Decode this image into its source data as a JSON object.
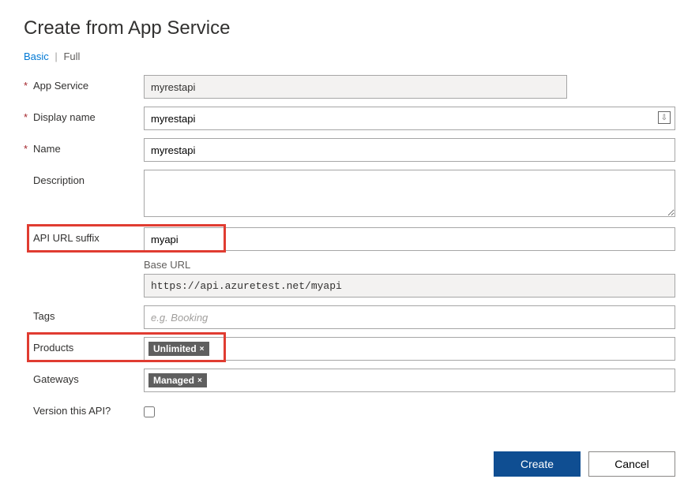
{
  "title": "Create from App Service",
  "tabs": {
    "basic": "Basic",
    "full": "Full",
    "sep": "|"
  },
  "fields": {
    "appService": {
      "label": "App Service",
      "value": "myrestapi"
    },
    "displayName": {
      "label": "Display name",
      "value": "myrestapi"
    },
    "name": {
      "label": "Name",
      "value": "myrestapi"
    },
    "description": {
      "label": "Description",
      "value": ""
    },
    "apiUrlSuffix": {
      "label": "API URL suffix",
      "value": "myapi"
    },
    "baseUrl": {
      "label": "Base URL",
      "value": "https://api.azuretest.net/myapi"
    },
    "tags": {
      "label": "Tags",
      "placeholder": "e.g. Booking",
      "value": ""
    },
    "products": {
      "label": "Products",
      "chip": "Unlimited"
    },
    "gateways": {
      "label": "Gateways",
      "chip": "Managed"
    },
    "version": {
      "label": "Version this API?",
      "checked": false
    }
  },
  "chipClose": "×",
  "buttons": {
    "create": "Create",
    "cancel": "Cancel"
  },
  "req": "*"
}
